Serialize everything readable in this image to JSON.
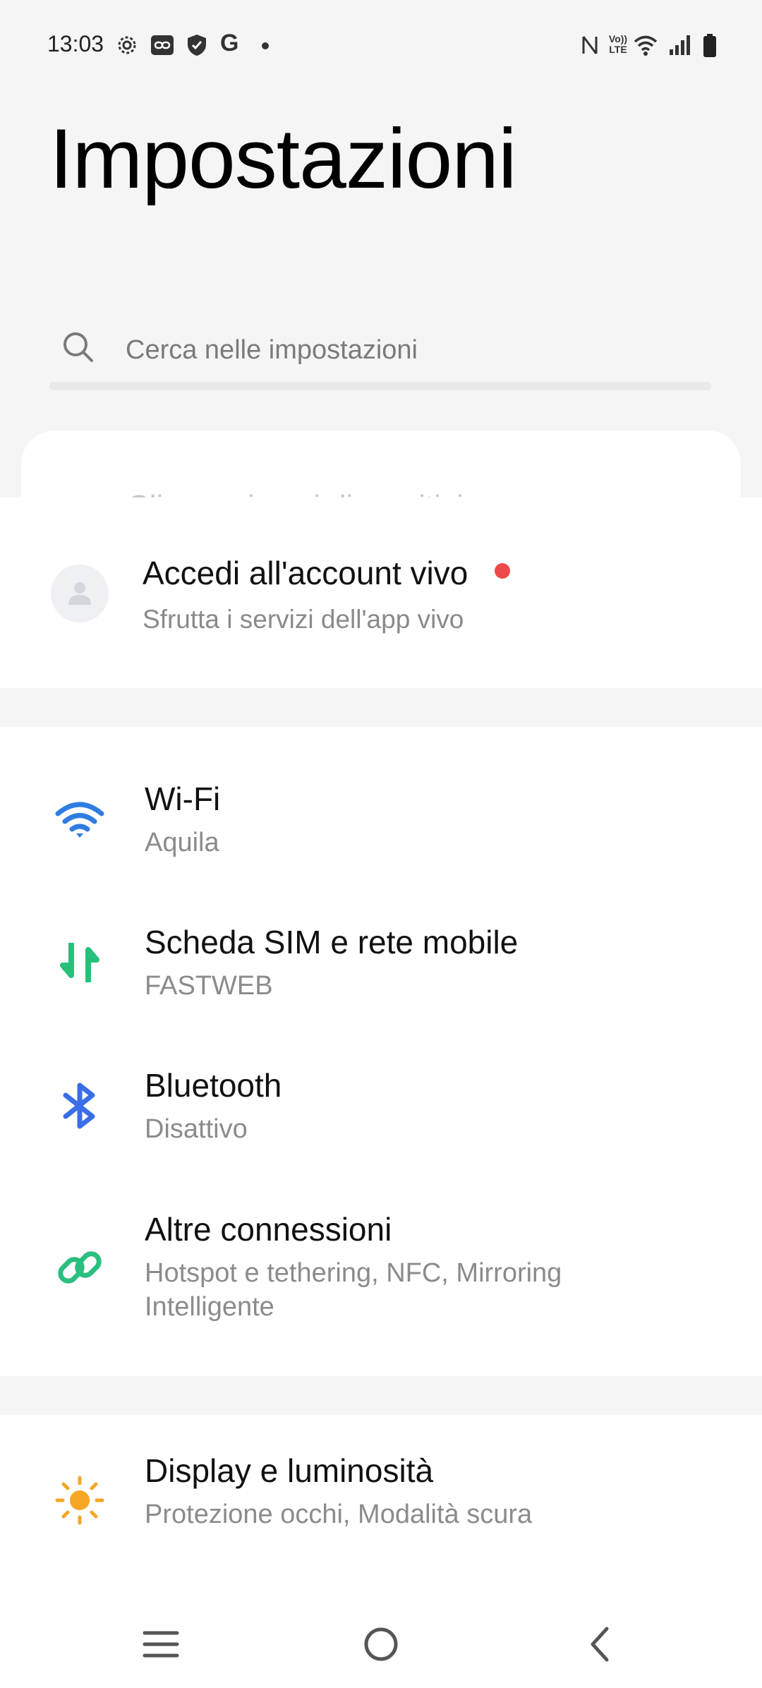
{
  "status_bar": {
    "time": "13:03",
    "left_icons": [
      "gear-icon",
      "link-badge-icon",
      "shield-icon",
      "google-g-icon",
      "dot-icon"
    ],
    "right_icons": [
      "nfc-icon",
      "volte-icon",
      "wifi-signal-icon",
      "cell-signal-icon",
      "battery-icon"
    ],
    "volte_text": "Vo)) LTE",
    "google_text": "G"
  },
  "header": {
    "title": "Impostazioni"
  },
  "search": {
    "placeholder": "Cerca nelle impostazioni"
  },
  "peek": {
    "text": "Cliccare i suoi dispositivi"
  },
  "account": {
    "title": "Accedi all'account vivo",
    "subtitle": "Sfrutta i servizi dell'app vivo",
    "badge_color": "#ef4a4a"
  },
  "connections": [
    {
      "title": "Wi-Fi",
      "subtitle": "Aquila",
      "icon": "wifi-icon",
      "color": "#2f7de1"
    },
    {
      "title": "Scheda SIM e rete mobile",
      "subtitle": "FASTWEB",
      "icon": "data-transfer-icon",
      "color": "#27c07a"
    },
    {
      "title": "Bluetooth",
      "subtitle": "Disattivo",
      "icon": "bluetooth-icon",
      "color": "#3a6ee8"
    },
    {
      "title": "Altre connessioni",
      "subtitle": "Hotspot e tethering, NFC, Mirroring Intelligente",
      "icon": "link-icon",
      "color": "#2bbf7f"
    }
  ],
  "display": {
    "title": "Display e luminosità",
    "subtitle": "Protezione occhi, Modalità scura",
    "icon": "sun-icon",
    "color": "#f5a623"
  },
  "navbar": {
    "items": [
      "menu-icon",
      "home-icon",
      "back-icon"
    ]
  }
}
